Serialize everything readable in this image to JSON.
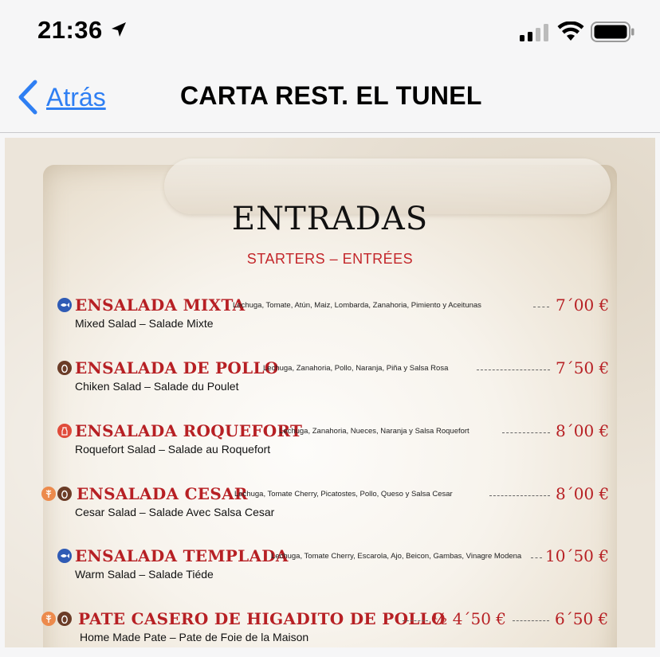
{
  "status_bar": {
    "time": "21:36"
  },
  "nav": {
    "back_label": "Atrás",
    "title": "CARTA REST. EL TUNEL"
  },
  "menu": {
    "heading": "ENTRADAS",
    "subheading": "STARTERS – ENTRÉES",
    "items": [
      {
        "icons": [
          "blue-fish-icon"
        ],
        "name": "ENSALADA MIXTA",
        "ingredients": "Lechuga, Tomate, Atún, Maiz, Lombarda, Zanahoria, Pimiento y Aceitunas",
        "price": "7´00 €",
        "translation": "Mixed Salad – Salade Mixte"
      },
      {
        "icons": [
          "brown-egg-icon"
        ],
        "name": "ENSALADA DE POLLO",
        "ingredients": "Lechuga, Zanahoria, Pollo, Naranja, Piña y Salsa Rosa",
        "price": "7´50 €",
        "translation": "Chiken Salad – Salade du Poulet"
      },
      {
        "icons": [
          "red-milk-icon"
        ],
        "name": "ENSALADA ROQUEFORT",
        "ingredients": "Lechuga, Zanahoria, Nueces, Naranja y Salsa Roquefort",
        "price": "8´00 €",
        "translation": "Roquefort Salad – Salade au Roquefort"
      },
      {
        "icons": [
          "orange-gluten-icon",
          "brown-egg-icon"
        ],
        "name": "ENSALADA CESAR",
        "ingredients": "Lechuga, Tomate Cherry, Picatostes, Pollo, Queso y Salsa Cesar",
        "price": "8´00 €",
        "translation": "Cesar Salad – Salade Avec Salsa Cesar"
      },
      {
        "icons": [
          "blue-fish-icon"
        ],
        "name": "ENSALADA TEMPLADA",
        "ingredients": "Lechuga, Tomate Cherry, Escarola, Ajo, Beicon, Gambas, Vinagre Modena",
        "price": "10´50 €",
        "translation": "Warm Salad – Salade Tiéde"
      },
      {
        "icons": [
          "orange-gluten-icon",
          "brown-egg-icon"
        ],
        "name": "PATE CASERO DE HIGADITO DE POLLO",
        "half_price": "½ 4´50 €",
        "price": "6´50 €",
        "translation": "Home Made Pate – Pate de Foie de la Maison"
      }
    ]
  },
  "colors": {
    "accent": "#2f7ff3",
    "menu_red": "#b72024"
  }
}
